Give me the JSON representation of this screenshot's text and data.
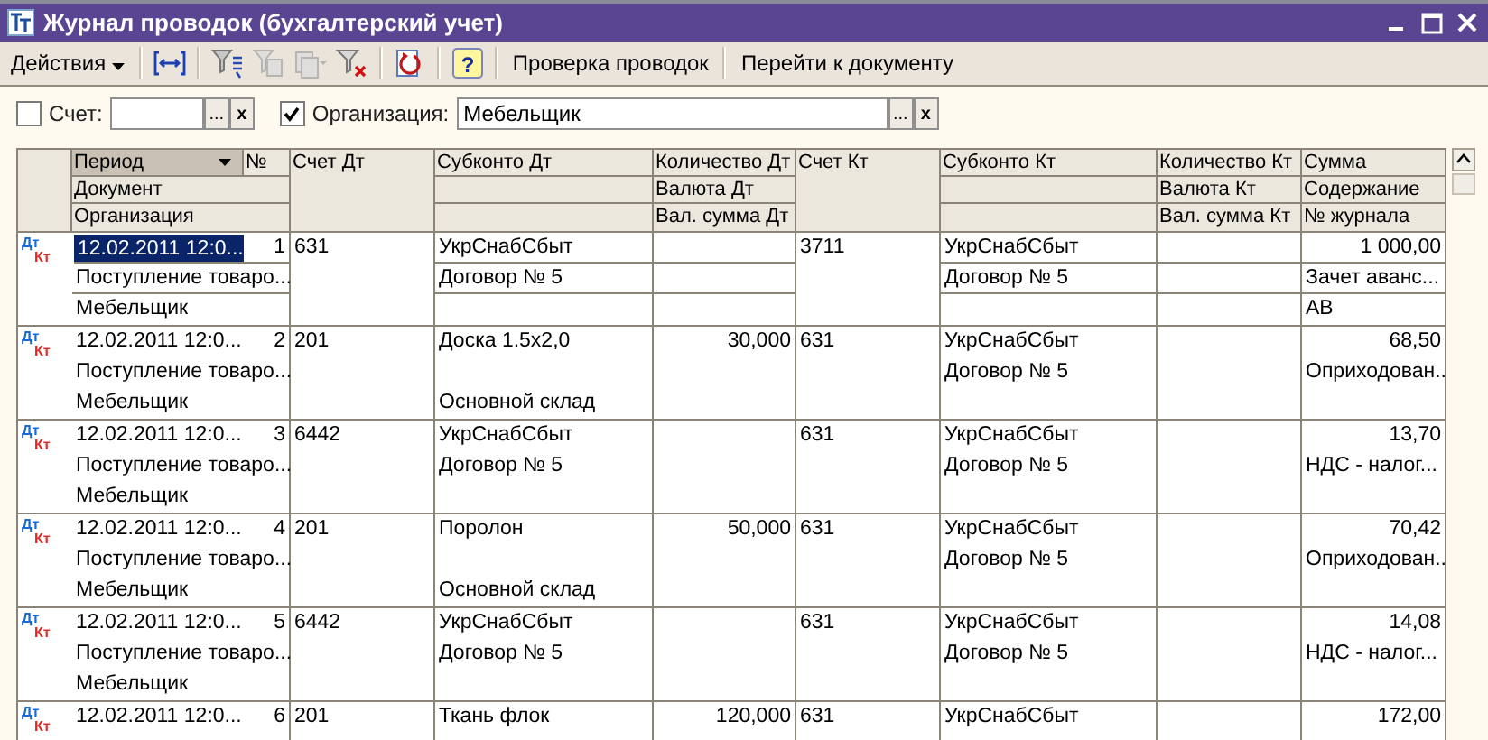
{
  "window": {
    "title": "Журнал проводок (бухгалтерский учет)"
  },
  "toolbar": {
    "actions_menu": "Действия",
    "buttons": [
      {
        "kind": "link-columns",
        "disabled": false
      },
      {
        "kind": "filter-list",
        "disabled": false
      },
      {
        "kind": "copy-document",
        "disabled": true
      },
      {
        "kind": "paste-menu",
        "disabled": true
      },
      {
        "kind": "filter-clear",
        "disabled": false
      },
      {
        "kind": "refresh",
        "disabled": false
      },
      {
        "kind": "help",
        "disabled": false,
        "label": "?"
      }
    ],
    "text_buttons": [
      "Проверка проводок",
      "Перейти к документу"
    ]
  },
  "filters": [
    {
      "label": "Счет:",
      "checked": false,
      "select_label": "...",
      "clear_label": "x"
    },
    {
      "label": "Организация:",
      "checked": true,
      "value": "Мебельщик",
      "select_label": "...",
      "clear_label": "x"
    }
  ],
  "table": {
    "period_sorted": true,
    "header": {
      "period": "Период",
      "number": "№",
      "document": "Документ",
      "organization": "Организация",
      "account_dt": "Счет Дт",
      "subconto_dt_1": "Субконто Дт",
      "quantity_dt": "Количество Дт",
      "currency_dt": "Валюта Дт",
      "currency_sum_dt": "Вал. сумма Дт",
      "account_kt": "Счет Кт",
      "subconto_kt_1": "Субконто Кт",
      "quantity_kt": "Количество Кт",
      "currency_kt": "Валюта Кт",
      "currency_sum_kt": "Вал. сумма Кт",
      "amount": "Сумма",
      "content": "Содержание",
      "journal": "№ журнала"
    },
    "rows": [
      {
        "selected": true,
        "marker": {
          "debit": "Дт",
          "credit": "Кт"
        },
        "period": "12.02.2011 12:0...",
        "number": "1",
        "document": "Поступление товаро...",
        "organization": "Мебельщик",
        "account_dt": "631",
        "subconto_dt_1": "УкрСнабСбыт",
        "subconto_dt_2": "Договор № 5",
        "account_kt": "3711",
        "subconto_kt_1": "УкрСнабСбыт",
        "subconto_kt_2": "Договор № 5",
        "amount": "1 000,00",
        "content": "Зачет аванс...",
        "journal": "АВ"
      },
      {
        "selected": false,
        "marker": {
          "debit": "Дт",
          "credit": "Кт"
        },
        "period": "12.02.2011 12:0...",
        "number": "2",
        "document": "Поступление товаро...",
        "organization": "Мебельщик",
        "account_dt": "201",
        "subconto_dt_1": "Доска 1.5x2,0",
        "subconto_dt_3": "Основной склад",
        "quantity_dt": "30,000",
        "account_kt": "631",
        "subconto_kt_1": "УкрСнабСбыт",
        "subconto_kt_2": "Договор № 5",
        "amount": "68,50",
        "content": "Оприходован..."
      },
      {
        "selected": false,
        "marker": {
          "debit": "Дт",
          "credit": "Кт"
        },
        "period": "12.02.2011 12:0...",
        "number": "3",
        "document": "Поступление товаро...",
        "organization": "Мебельщик",
        "account_dt": "6442",
        "subconto_dt_1": "УкрСнабСбыт",
        "subconto_dt_2": "Договор № 5",
        "account_kt": "631",
        "subconto_kt_1": "УкрСнабСбыт",
        "subconto_kt_2": "Договор № 5",
        "amount": "13,70",
        "content": "НДС - налог..."
      },
      {
        "selected": false,
        "marker": {
          "debit": "Дт",
          "credit": "Кт"
        },
        "period": "12.02.2011 12:0...",
        "number": "4",
        "document": "Поступление товаро...",
        "organization": "Мебельщик",
        "account_dt": "201",
        "subconto_dt_1": "Поролон",
        "subconto_dt_3": "Основной склад",
        "quantity_dt": "50,000",
        "account_kt": "631",
        "subconto_kt_1": "УкрСнабСбыт",
        "subconto_kt_2": "Договор № 5",
        "amount": "70,42",
        "content": "Оприходован..."
      },
      {
        "selected": false,
        "marker": {
          "debit": "Дт",
          "credit": "Кт"
        },
        "period": "12.02.2011 12:0...",
        "number": "5",
        "document": "Поступление товаро...",
        "organization": "Мебельщик",
        "account_dt": "6442",
        "subconto_dt_1": "УкрСнабСбыт",
        "subconto_dt_2": "Договор № 5",
        "account_kt": "631",
        "subconto_kt_1": "УкрСнабСбыт",
        "subconto_kt_2": "Договор № 5",
        "amount": "14,08",
        "content": "НДС - налог..."
      },
      {
        "selected": false,
        "marker": {
          "debit": "Дт",
          "credit": "Кт"
        },
        "period": "12.02.2011 12:0...",
        "number": "6",
        "account_dt": "201",
        "subconto_dt_1": "Ткань флок",
        "quantity_dt": "120,000",
        "account_kt": "631",
        "subconto_kt_1": "УкрСнабСбыт",
        "amount": "172,00"
      }
    ]
  }
}
